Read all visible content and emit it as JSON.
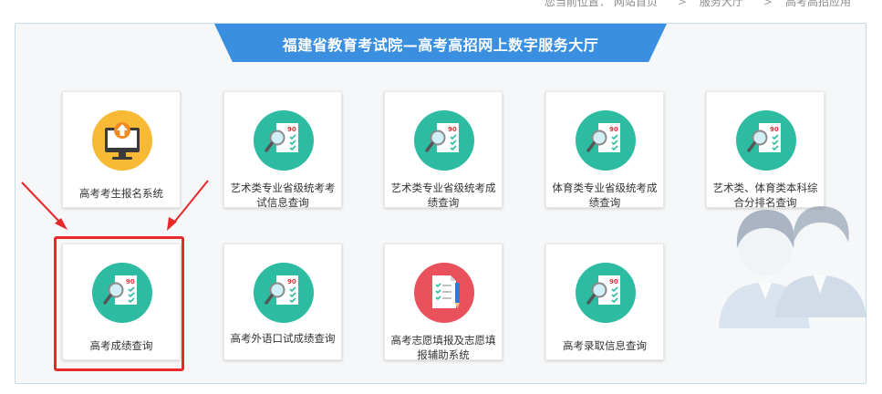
{
  "breadcrumb": {
    "prefix": "您当前位置：",
    "items": [
      "网站首页",
      "服务大厅",
      "高考高招应用"
    ]
  },
  "banner": {
    "title": "福建省教育考试院—高考高招网上数字服务大厅"
  },
  "cards": [
    {
      "label": "高考考生报名系统",
      "icon": "computer-upload-icon"
    },
    {
      "label": "艺术类专业省级统考考试信息查询",
      "icon": "score-report-icon"
    },
    {
      "label": "艺术类专业省级统考成绩查询",
      "icon": "score-report-icon"
    },
    {
      "label": "体育类专业省级统考成绩查询",
      "icon": "score-report-icon"
    },
    {
      "label": "艺术类、体育类本科综合分排名查询",
      "icon": "score-report-icon"
    },
    {
      "label": "高考成绩查询",
      "icon": "score-report-icon",
      "highlighted": true
    },
    {
      "label": "高考外语口试成绩查询",
      "icon": "score-report-icon"
    },
    {
      "label": "高考志愿填报及志愿填报辅助系统",
      "icon": "checklist-pen-icon"
    },
    {
      "label": "高考录取信息查询",
      "icon": "score-report-icon"
    }
  ],
  "colors": {
    "banner": "#3b8fe0",
    "teal": "#2dbba1",
    "yellow": "#f8b935",
    "red": "#e9515d",
    "highlight": "#e8282a"
  }
}
